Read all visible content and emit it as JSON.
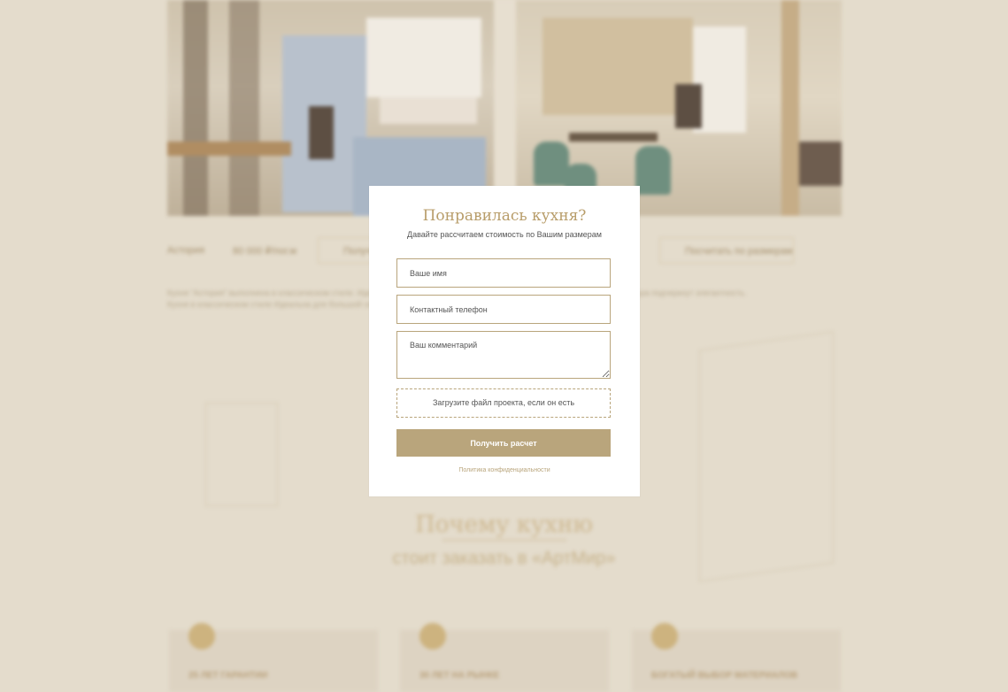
{
  "modal": {
    "title": "Понравилась кухня?",
    "subtitle": "Давайте рассчитаем стоимость по Вашим размерам",
    "name_placeholder": "Ваше имя",
    "phone_placeholder": "Контактный телефон",
    "comment_placeholder": "Ваш комментарий",
    "upload_label": "Загрузите файл проекта, если он есть",
    "submit_label": "Получить расчет",
    "policy_link": "Политика конфиденциальности"
  },
  "background": {
    "info": {
      "style": "Астория",
      "price": "80 000 ₽/пог.м",
      "btn_left": "Получить",
      "btn_right": "Посчитать по размерам"
    },
    "description": "Кухня “Астория” выполнена в классическом стиле. Идеально впишется в интерьер, а светлые фасады и классическая фурнитура подчеркнут элегантность. Кухня в классическом стиле Идеальна для большой семьи.",
    "why_title": "Почему кухню",
    "why_subtitle": "стоит заказать в «АртМир»",
    "benefits": [
      "25 ЛЕТ ГАРАНТИИ",
      "30 ЛЕТ НА РЫНКЕ",
      "БОГАТЫЙ ВЫБОР МАТЕРИАЛОВ"
    ]
  },
  "colors": {
    "accent": "#b9a57c",
    "overlay_bg": "#e4dccc"
  }
}
